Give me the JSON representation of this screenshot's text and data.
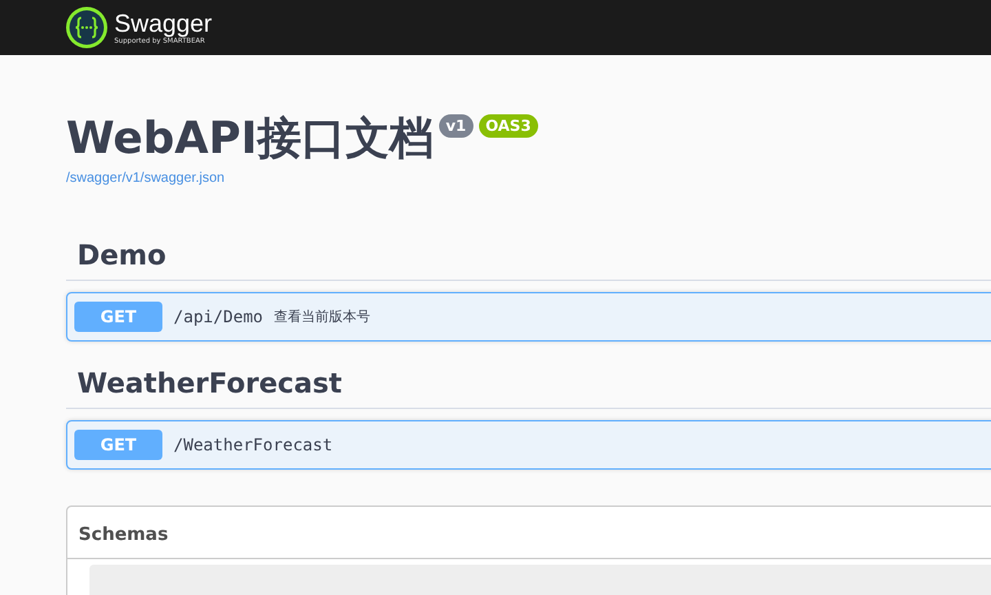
{
  "topbar": {
    "brand": "Swagger",
    "tagline": "Supported by SMARTBEAR"
  },
  "info": {
    "title": "WebAPI接口文档",
    "version": "v1",
    "spec": "OAS3",
    "url": "/swagger/v1/swagger.json"
  },
  "tags": [
    {
      "name": "Demo",
      "operations": [
        {
          "method": "GET",
          "path": "/api/Demo",
          "summary": "查看当前版本号"
        }
      ]
    },
    {
      "name": "WeatherForecast",
      "operations": [
        {
          "method": "GET",
          "path": "/WeatherForecast"
        }
      ]
    }
  ],
  "schemas": {
    "title": "Schemas"
  }
}
